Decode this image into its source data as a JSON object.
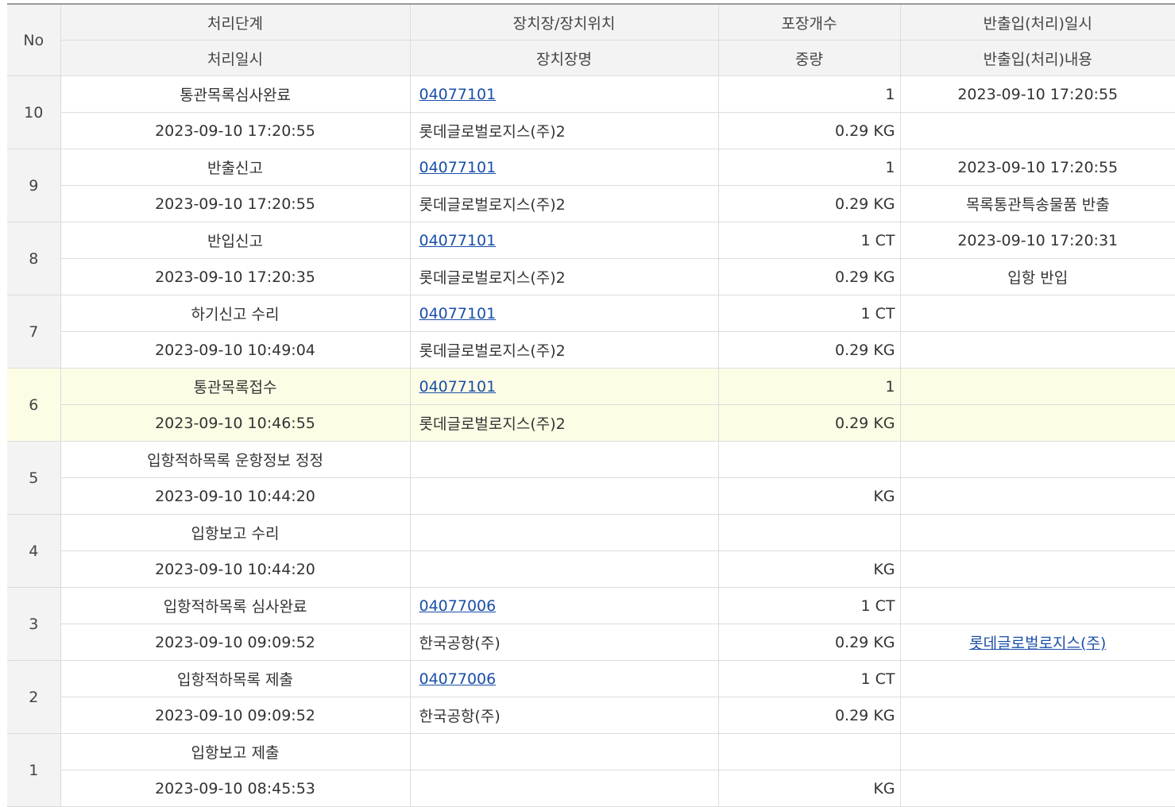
{
  "headers": {
    "no": "No",
    "row1": [
      "처리단계",
      "장치장/장치위치",
      "포장개수",
      "반출입(처리)일시"
    ],
    "row2": [
      "처리일시",
      "장치장명",
      "중량",
      "반출입(처리)내용"
    ]
  },
  "rows": [
    {
      "no": "10",
      "stage": "통관목록심사완료",
      "datetime": "2023-09-10 17:20:55",
      "location_code": "04077101",
      "location_name": "롯데글로벌로지스(주)2",
      "packages": "1",
      "weight": "0.29 KG",
      "io_datetime": "2023-09-10 17:20:55",
      "io_content": "",
      "highlighted": false,
      "io_content_link": false
    },
    {
      "no": "9",
      "stage": "반출신고",
      "datetime": "2023-09-10 17:20:55",
      "location_code": "04077101",
      "location_name": "롯데글로벌로지스(주)2",
      "packages": "1",
      "weight": "0.29 KG",
      "io_datetime": "2023-09-10 17:20:55",
      "io_content": "목록통관특송물품 반출",
      "highlighted": false,
      "io_content_link": false
    },
    {
      "no": "8",
      "stage": "반입신고",
      "datetime": "2023-09-10 17:20:35",
      "location_code": "04077101",
      "location_name": "롯데글로벌로지스(주)2",
      "packages": "1 CT",
      "weight": "0.29 KG",
      "io_datetime": "2023-09-10 17:20:31",
      "io_content": "입항 반입",
      "highlighted": false,
      "io_content_link": false
    },
    {
      "no": "7",
      "stage": "하기신고 수리",
      "datetime": "2023-09-10 10:49:04",
      "location_code": "04077101",
      "location_name": "롯데글로벌로지스(주)2",
      "packages": "1 CT",
      "weight": "0.29 KG",
      "io_datetime": "",
      "io_content": "",
      "highlighted": false,
      "io_content_link": false
    },
    {
      "no": "6",
      "stage": "통관목록접수",
      "datetime": "2023-09-10 10:46:55",
      "location_code": "04077101",
      "location_name": "롯데글로벌로지스(주)2",
      "packages": "1",
      "weight": "0.29 KG",
      "io_datetime": "",
      "io_content": "",
      "highlighted": true,
      "io_content_link": false
    },
    {
      "no": "5",
      "stage": "입항적하목록 운항정보 정정",
      "datetime": "2023-09-10 10:44:20",
      "location_code": "",
      "location_name": "",
      "packages": "",
      "weight": "KG",
      "io_datetime": "",
      "io_content": "",
      "highlighted": false,
      "io_content_link": false
    },
    {
      "no": "4",
      "stage": "입항보고 수리",
      "datetime": "2023-09-10 10:44:20",
      "location_code": "",
      "location_name": "",
      "packages": "",
      "weight": "KG",
      "io_datetime": "",
      "io_content": "",
      "highlighted": false,
      "io_content_link": false
    },
    {
      "no": "3",
      "stage": "입항적하목록 심사완료",
      "datetime": "2023-09-10 09:09:52",
      "location_code": "04077006",
      "location_name": "한국공항(주)",
      "packages": "1 CT",
      "weight": "0.29 KG",
      "io_datetime": "",
      "io_content": "롯데글로벌로지스(주)",
      "highlighted": false,
      "io_content_link": true
    },
    {
      "no": "2",
      "stage": "입항적하목록 제출",
      "datetime": "2023-09-10 09:09:52",
      "location_code": "04077006",
      "location_name": "한국공항(주)",
      "packages": "1 CT",
      "weight": "0.29 KG",
      "io_datetime": "",
      "io_content": "",
      "highlighted": false,
      "io_content_link": false
    },
    {
      "no": "1",
      "stage": "입항보고 제출",
      "datetime": "2023-09-10 08:45:53",
      "location_code": "",
      "location_name": "",
      "packages": "",
      "weight": "KG",
      "io_datetime": "",
      "io_content": "",
      "highlighted": false,
      "io_content_link": false
    }
  ]
}
